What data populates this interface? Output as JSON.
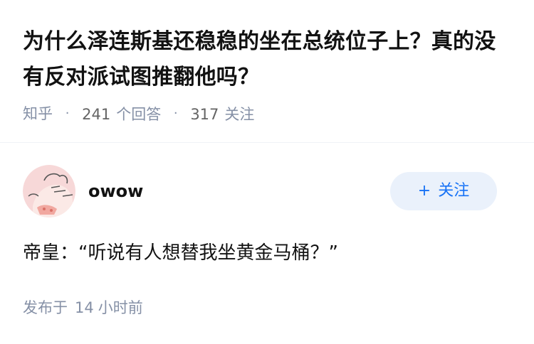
{
  "question": {
    "title": "为什么泽连斯基还稳稳的坐在总统位子上？真的没有反对派试图推翻他吗？",
    "source": "知乎",
    "separator": "·",
    "answers_count": "241",
    "answers_label": "个回答",
    "followers_count": "317",
    "followers_label": "关注"
  },
  "answer": {
    "author": {
      "name": "owow",
      "avatar_icon": "cartoon-avatar-icon"
    },
    "follow_button": {
      "plus": "+",
      "label": "关注"
    },
    "content": "帝皇：“听说有人想替我坐黄金马桶？”",
    "posted_prefix": "发布于",
    "posted_number": "14",
    "posted_unit": "小时前"
  },
  "colors": {
    "text": "#121212",
    "meta": "#8590a6",
    "accent": "#1772f6",
    "follow_bg": "#eaf1fb",
    "avatar_bg": "#f7d8d8"
  }
}
